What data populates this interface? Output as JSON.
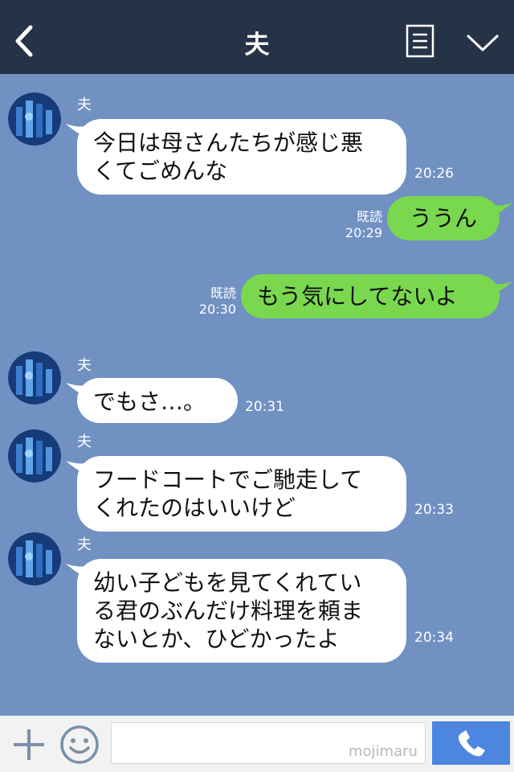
{
  "header": {
    "title": "夫",
    "back_icon": "chevron-left-icon",
    "menu_icon": "document-icon",
    "collapse_icon": "chevron-down-icon",
    "background": "#263246"
  },
  "chat": {
    "background": "#7091c2",
    "messages": [
      {
        "direction": "in",
        "sender": "夫",
        "text_lines": [
          "今日は母さんたちが感じ悪",
          "くてごめんな"
        ],
        "time": "20:26"
      },
      {
        "direction": "out",
        "read": "既読",
        "text_lines": [
          "ううん"
        ],
        "time": "20:29"
      },
      {
        "direction": "out",
        "read": "既読",
        "text_lines": [
          "もう気にしてないよ"
        ],
        "time": "20:30"
      },
      {
        "direction": "in",
        "sender": "夫",
        "text_lines": [
          "でもさ…。"
        ],
        "time": "20:31"
      },
      {
        "direction": "in",
        "sender": "夫",
        "text_lines": [
          "フードコートでご馳走して",
          "くれたのはいいけど"
        ],
        "time": "20:33"
      },
      {
        "direction": "in",
        "sender": "夫",
        "text_lines": [
          "幼い子どもを見てくれてい",
          "る君のぶんだけ料理を頼ま",
          "ないとか、ひどかったよ"
        ],
        "time": "20:34"
      }
    ]
  },
  "input_bar": {
    "plus_icon": "plus-icon",
    "emoji_icon": "smiley-icon",
    "input_value": "",
    "watermark": "mojimaru",
    "call_icon": "phone-icon",
    "call_color": "#4c86e0"
  },
  "colors": {
    "incoming_bubble": "#ffffff",
    "outgoing_bubble": "#7ad84e"
  }
}
